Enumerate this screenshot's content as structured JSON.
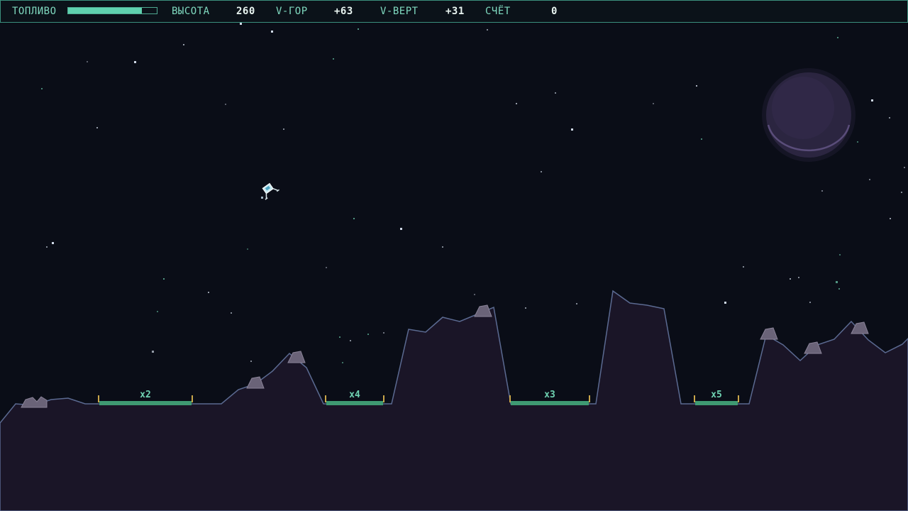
{
  "hud": {
    "fuel_label": "ТОПЛИВО",
    "fuel_level": 0.83,
    "altitude_label": "ВЫСОТА",
    "altitude_value": "260",
    "vh_label": "V-ГОР",
    "vh_value": "+63",
    "vv_label": "V-ВЕРТ",
    "vv_value": "+31",
    "score_label": "СЧЁТ",
    "score_value": "0"
  },
  "pads": [
    {
      "multiplier": "x2"
    },
    {
      "multiplier": "x4"
    },
    {
      "multiplier": "x3"
    },
    {
      "multiplier": "x5"
    }
  ],
  "colors": {
    "sky": "#0a0d17",
    "terrain_fill": "#1a1527",
    "terrain_edge": "#5b6a91",
    "pad": "#3f9a72",
    "pad_flag": "#c9a64a",
    "hud_text": "#7fd9bf",
    "planet": "#2b2540"
  },
  "icons": {
    "ship": "lander-ship-icon",
    "planet": "planet-icon",
    "rock": "boulder-icon"
  }
}
